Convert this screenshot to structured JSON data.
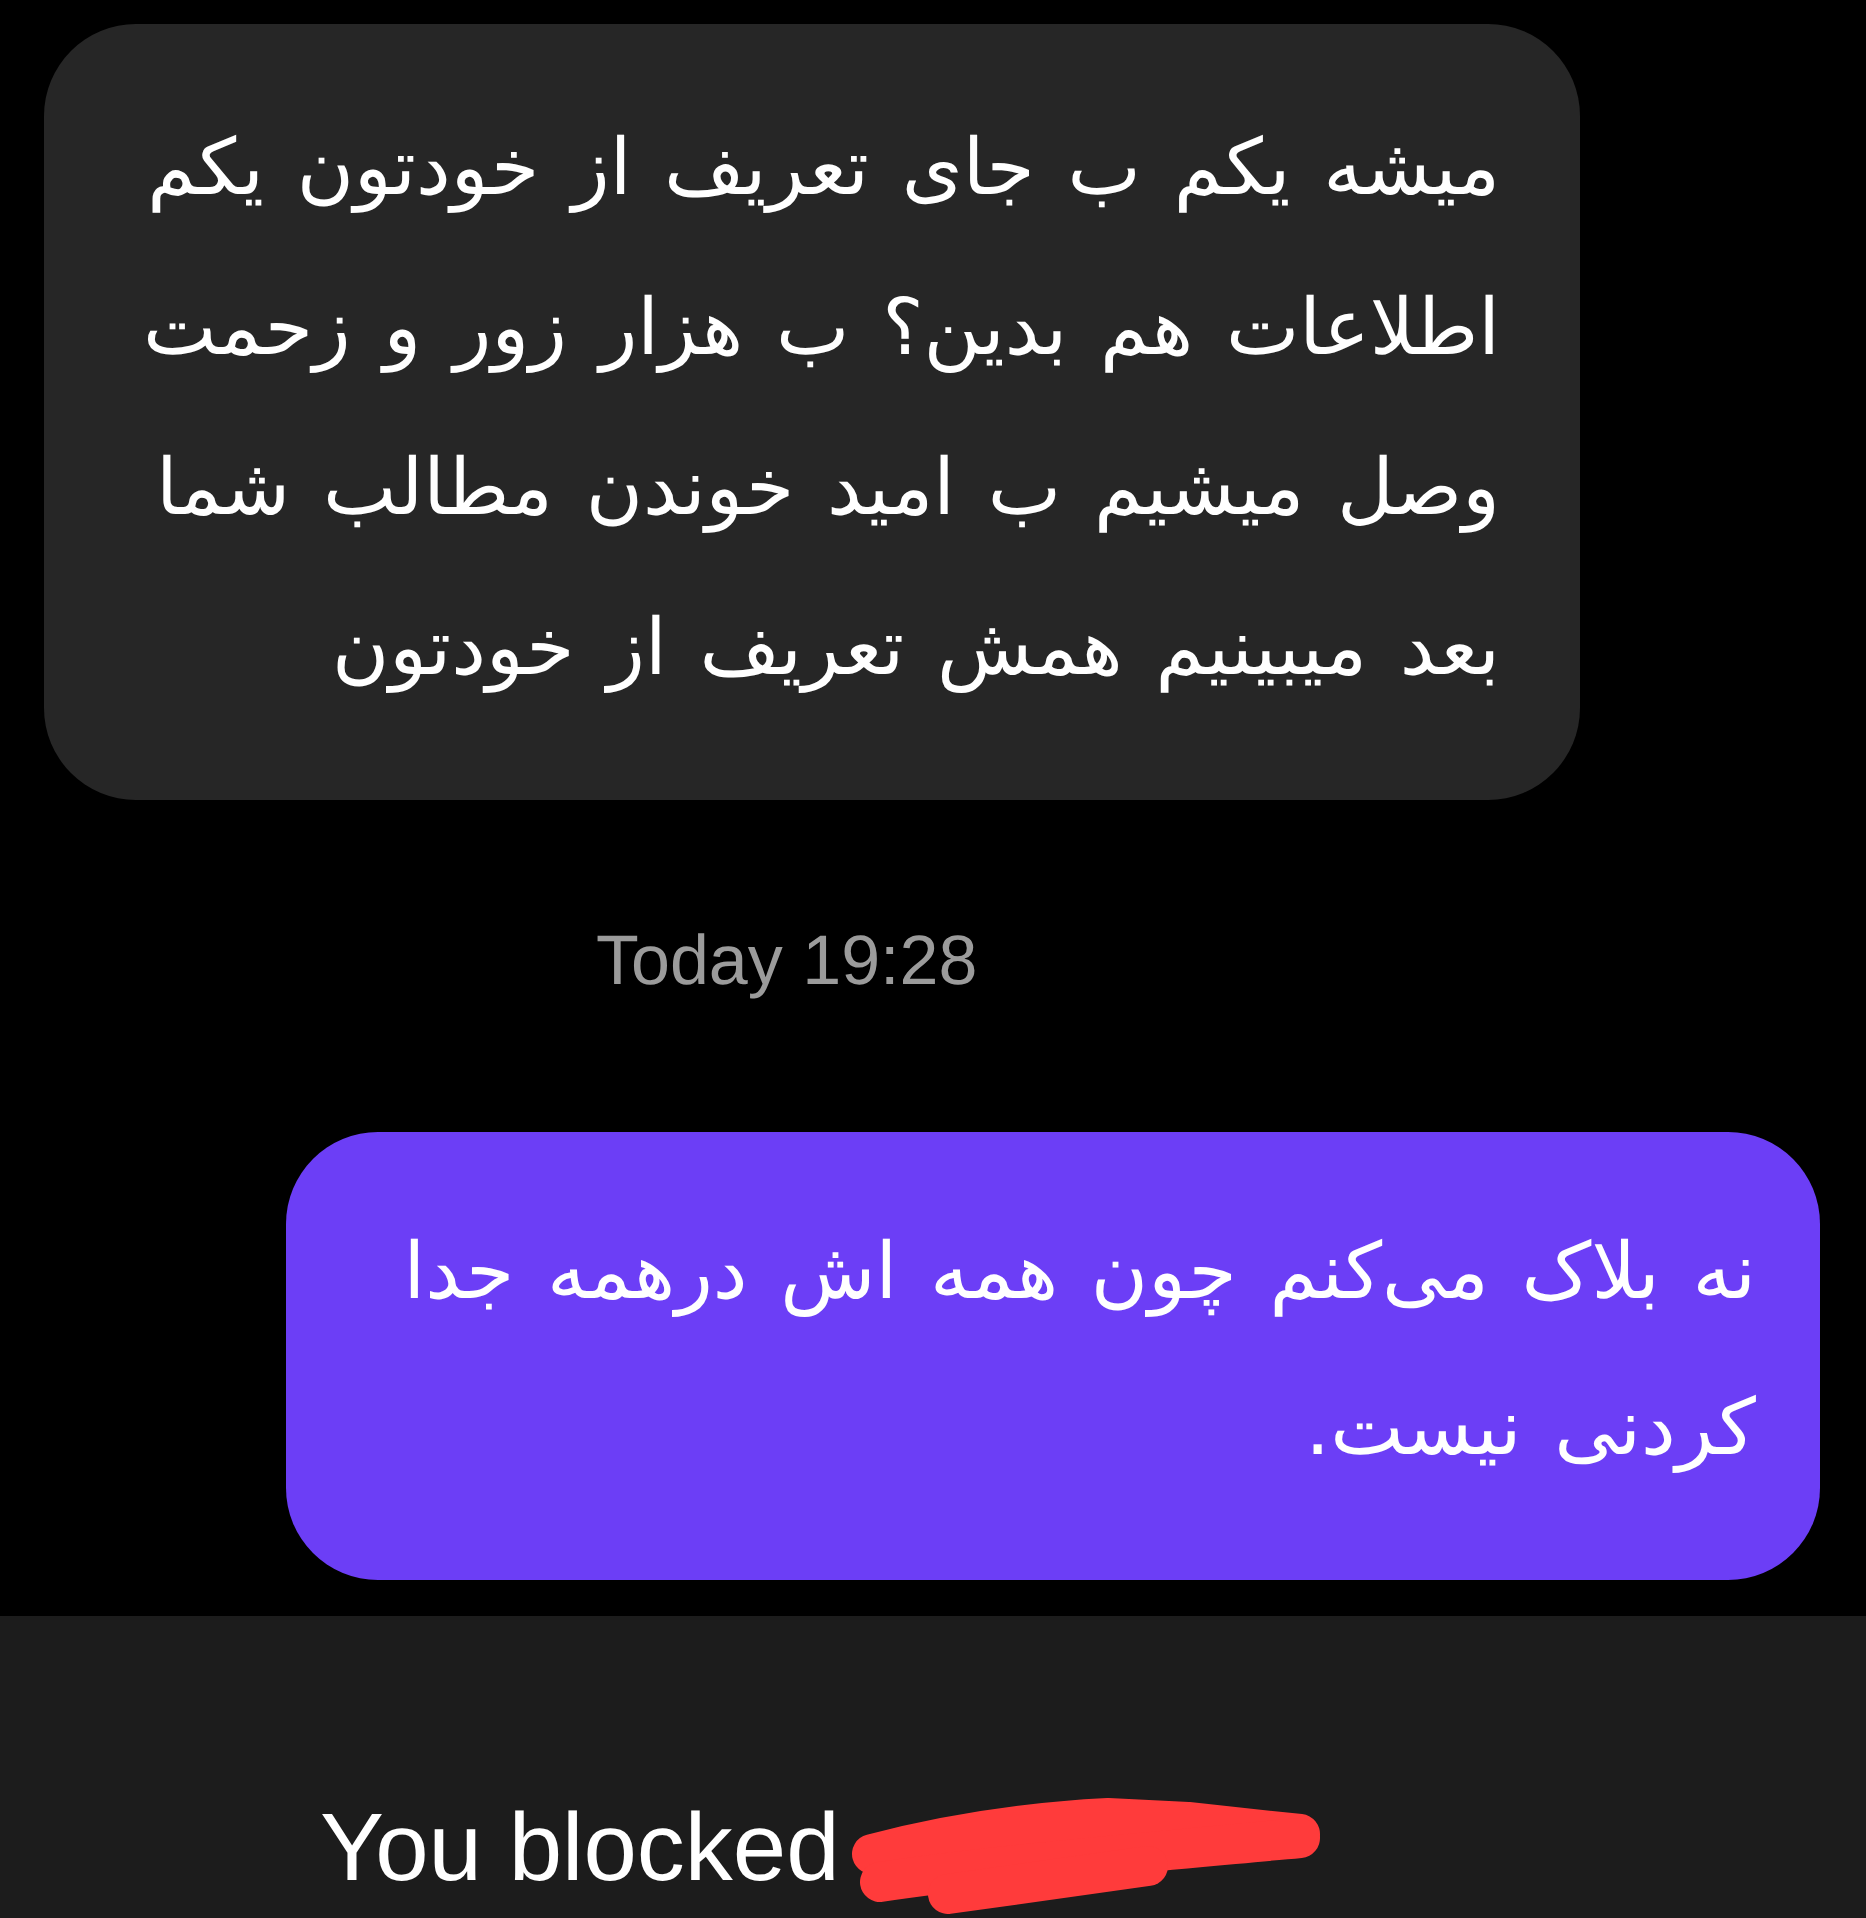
{
  "messages": [
    {
      "kind": "received",
      "text": "میشه یکم ب جای تعریف از خودتون یکم اطلاعات هم بدین؟ ب هزار زور و زحمت وصل میشیم ب امید خوندن مطالب شما بعد میبینیم همش تعریف از خودتون"
    },
    {
      "kind": "timestamp",
      "text": "Today 19:28"
    },
    {
      "kind": "sent",
      "text": "نه بلاک می‌کنم چون همه اش درهمه جدا کردنی نیست."
    }
  ],
  "blocked_banner": {
    "text": "You blocked",
    "name_redacted": true
  }
}
